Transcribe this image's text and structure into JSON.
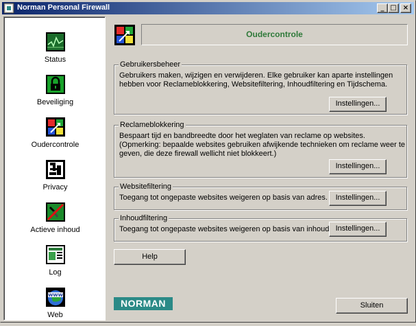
{
  "window": {
    "title": "Norman Personal Firewall",
    "minimize": "_",
    "maximize": "□",
    "close": "×"
  },
  "sidebar": {
    "items": [
      {
        "label": "Status",
        "icon": "status-chart-icon"
      },
      {
        "label": "Beveiliging",
        "icon": "padlock-icon"
      },
      {
        "label": "Oudercontrole",
        "icon": "parental-control-icon"
      },
      {
        "label": "Privacy",
        "icon": "privacy-icon"
      },
      {
        "label": "Actieve inhoud",
        "icon": "active-content-icon"
      },
      {
        "label": "Log",
        "icon": "log-icon"
      },
      {
        "label": "Web",
        "icon": "www-globe-icon"
      }
    ]
  },
  "header": {
    "title": "Oudercontrole",
    "title_color": "#2f7a3a"
  },
  "sections": [
    {
      "title": "Gebruikersbeheer",
      "description": "Gebruikers maken, wijzigen en verwijderen. Elke gebruiker kan aparte instellingen hebben voor Reclameblokkering, Websitefiltering, Inhoudfiltering en Tijdschema.",
      "button": "Instellingen..."
    },
    {
      "title": "Reclameblokkering",
      "description": "Bespaart tijd en bandbreedte door het weglaten van reclame op websites. (Opmerking: bepaalde websites gebruiken afwijkende technieken om reclame weer te geven, die deze firewall wellicht niet blokkeert.)",
      "button": "Instellingen..."
    },
    {
      "title": "Websitefiltering",
      "description": "Toegang tot ongepaste websites weigeren op basis van adres.",
      "button": "Instellingen..."
    },
    {
      "title": "Inhoudfiltering",
      "description": "Toegang tot ongepaste websites weigeren op basis van inhoud.",
      "button": "Instellingen..."
    }
  ],
  "footer": {
    "help_button": "Help",
    "close_button": "Sluiten",
    "logo_text": "NORMAN",
    "logo_color": "#2b8a87"
  }
}
